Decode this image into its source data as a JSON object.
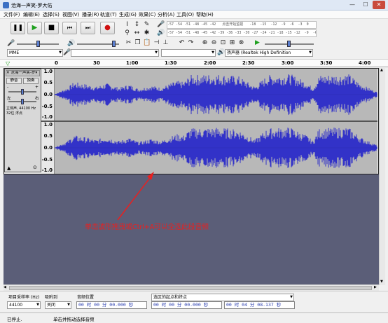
{
  "window": {
    "title": "沧海一声笑-罗大佑",
    "minimize": "—",
    "maximize": "☐",
    "close": "✕"
  },
  "menu": [
    "文件(F)",
    "编辑(E)",
    "选择(S)",
    "视图(V)",
    "播录(R)",
    "轨道(T)",
    "生成(G)",
    "效果(C)",
    "分析(A)",
    "工具(O)",
    "帮助(H)"
  ],
  "meters": {
    "record_scale": "-57 -54 -51 -48 -45 -42   点击开始监视   -18  -15  -12  -9  -6  -3  0",
    "play_scale": "-57 -54 -51 -48 -45 -42 -39 -36 -33 -30 -27 -24 -21 -18 -15 -12  -9  -6  -3  0"
  },
  "devices": {
    "host": "MME",
    "playback": "扬声器 (Realtek High Definition"
  },
  "ruler": {
    "marks": [
      "0",
      "30",
      "1:00",
      "1:30",
      "2:00",
      "2:30",
      "3:00",
      "3:30",
      "4:00"
    ]
  },
  "track": {
    "name": "沧海一声笑-罗",
    "mute": "静音",
    "solo": "独奏",
    "gain_minus": "-",
    "gain_plus": "+",
    "pan_left": "左",
    "pan_right": "右",
    "info1": "立体声, 44100 Hz",
    "info2": "32位 浮点",
    "scale": {
      "top": "1.0",
      "upper": "0.5",
      "mid": "0.0",
      "lower": "-0.5",
      "bottom": "-1.0"
    }
  },
  "annotation": "单击波形拖曳或Ctrl+A可以全选此段音频",
  "selection": {
    "rate_label": "项目采样率 (Hz)",
    "rate_value": "44100",
    "snap_label": "吸附到",
    "snap_value": "关闭",
    "audio_pos_label": "音频位置",
    "audio_pos": "00 时 00 分 00.000 秒",
    "sel_label": "选区的起点和终点",
    "sel_start": "00 时 00 分 00.000 秒",
    "sel_end": "00 时 04 分 08.137 秒"
  },
  "status": {
    "state": "已停止.",
    "hint": "单击并拖动选择音频"
  },
  "colors": {
    "wave": "#3232c8",
    "empty": "#5b5e78",
    "play": "#1ea01e",
    "record": "#d01010",
    "annotation": "#e82020"
  }
}
